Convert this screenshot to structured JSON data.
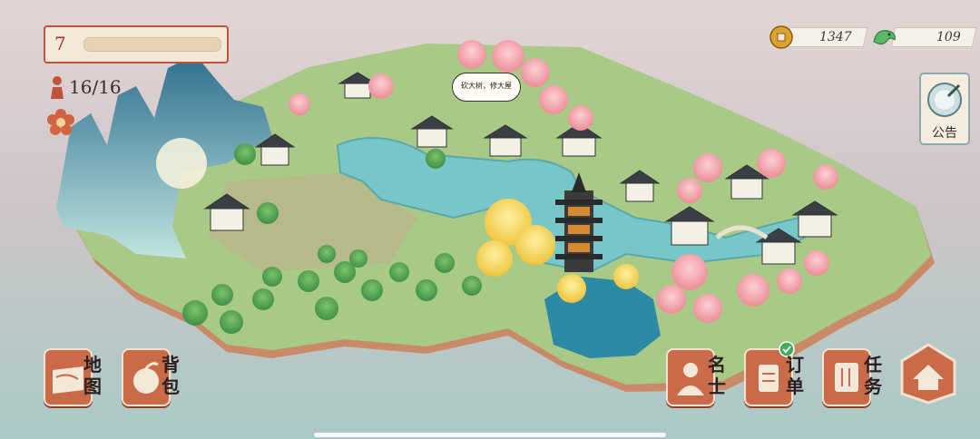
{
  "hud": {
    "level": "7",
    "level_progress": 0.0,
    "population": "16/16",
    "coins": "1347",
    "jade": "109",
    "notice_label": "公告"
  },
  "bubble": {
    "text": "砍大树，修大屋"
  },
  "bottom_bar": {
    "map": "地图",
    "bag": "背包",
    "celebrity": "名士",
    "order": "订单",
    "task": "任务"
  },
  "colors": {
    "accent": "#c96a49",
    "water": "#6fc1c4",
    "grass": "#9cc47f",
    "blossom": "#f3a6ad",
    "ginkgo": "#f6d85a"
  },
  "icons": [
    "settings-flower-icon",
    "coin-icon",
    "jade-dragon-icon",
    "notice-drum-icon",
    "map-icon",
    "bag-peach-icon",
    "celebrity-icon",
    "order-scroll-icon",
    "task-icon",
    "home-icon",
    "check-icon",
    "person-icon"
  ]
}
